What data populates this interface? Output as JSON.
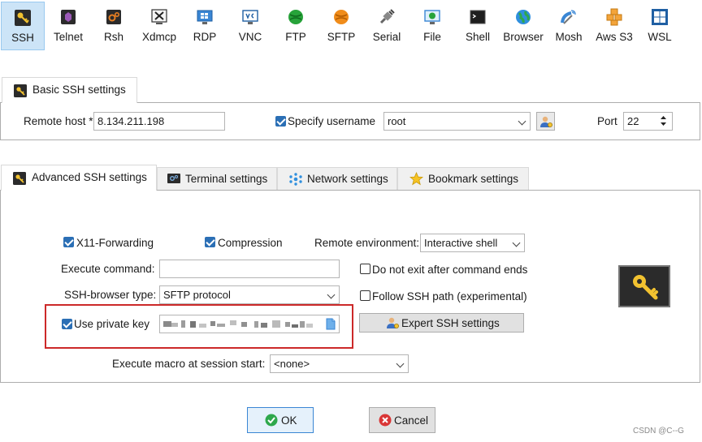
{
  "toolbar": {
    "items": [
      {
        "label": "SSH"
      },
      {
        "label": "Telnet"
      },
      {
        "label": "Rsh"
      },
      {
        "label": "Xdmcp"
      },
      {
        "label": "RDP"
      },
      {
        "label": "VNC"
      },
      {
        "label": "FTP"
      },
      {
        "label": "SFTP"
      },
      {
        "label": "Serial"
      },
      {
        "label": "File"
      },
      {
        "label": "Shell"
      },
      {
        "label": "Browser"
      },
      {
        "label": "Mosh"
      },
      {
        "label": "Aws S3"
      },
      {
        "label": "WSL"
      }
    ],
    "active": "SSH"
  },
  "basic": {
    "tab_label": "Basic SSH settings",
    "remote_host_label": "Remote host *",
    "remote_host_value": "8.134.211.198",
    "specify_username_label": "Specify username",
    "specify_username_checked": true,
    "username_value": "root",
    "port_label": "Port",
    "port_value": "22"
  },
  "tabs": [
    {
      "label": "Advanced SSH settings",
      "active": true
    },
    {
      "label": "Terminal settings"
    },
    {
      "label": "Network settings"
    },
    {
      "label": "Bookmark settings"
    }
  ],
  "advanced": {
    "x11_label": "X11-Forwarding",
    "x11_checked": true,
    "compression_label": "Compression",
    "compression_checked": true,
    "remote_env_label": "Remote environment:",
    "remote_env_value": "Interactive shell",
    "execute_command_label": "Execute command:",
    "execute_command_value": "",
    "do_not_exit_label": "Do not exit after command ends",
    "do_not_exit_checked": false,
    "ssh_browser_label": "SSH-browser type:",
    "ssh_browser_value": "SFTP protocol",
    "follow_path_label": "Follow SSH path (experimental)",
    "follow_path_checked": false,
    "private_key_label": "Use private key",
    "private_key_checked": true,
    "expert_button_label": "Expert SSH settings",
    "macro_label": "Execute macro at session start:",
    "macro_value": "<none>"
  },
  "colors": {
    "accent": "#2b6fb5",
    "highlight_box": "#cc2929",
    "active_tool_bg": "#cce4f7",
    "key_tile_bg": "#2b2b2b",
    "key_yellow": "#f2c230"
  },
  "footer": {
    "ok_label": "OK",
    "cancel_label": "Cancel",
    "watermark": "CSDN @C--G"
  }
}
